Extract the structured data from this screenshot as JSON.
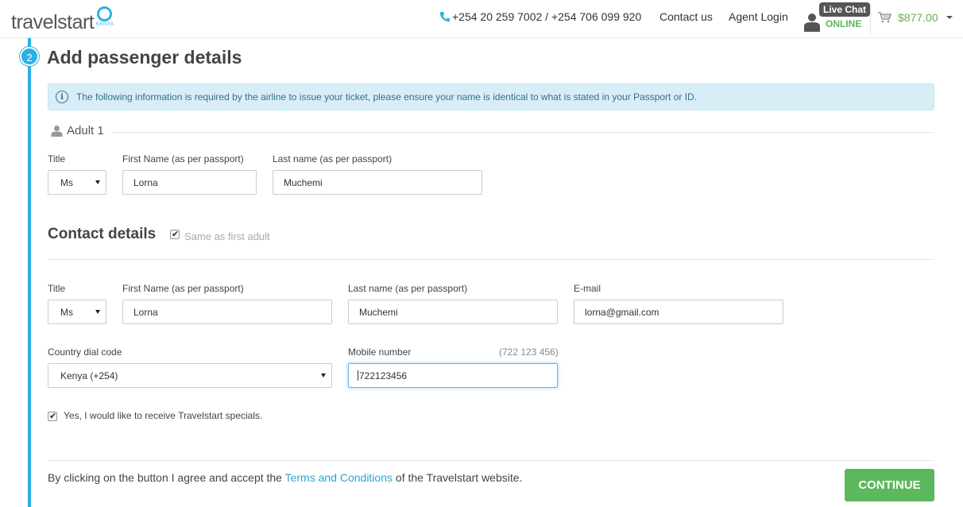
{
  "header": {
    "logo_text": "travelstart",
    "logo_sub": "KENYA",
    "phone": "+254 20 259 7002 / +254 706 099 920",
    "contact_us": "Contact us",
    "agent_login": "Agent Login",
    "live_chat": "Live Chat",
    "chat_status": "ONLINE",
    "cart_amount": "$877.00"
  },
  "step": {
    "number": "2",
    "title": "Add passenger details"
  },
  "info_alert": {
    "icon": "info-icon",
    "text": "The following information is required by the airline to issue your ticket, please ensure your name is identical to what is stated in your Passport or ID."
  },
  "adult": {
    "heading": "Adult 1",
    "title_label": "Title",
    "title_value": "Ms",
    "first_name_label": "First Name (as per passport)",
    "first_name_value": "Lorna",
    "last_name_label": "Last name (as per passport)",
    "last_name_value": "Muchemi"
  },
  "contact": {
    "heading": "Contact details",
    "same_as_first_adult": "Same as first adult",
    "same_checked": true,
    "title_label": "Title",
    "title_value": "Ms",
    "first_name_label": "First Name (as per passport)",
    "first_name_value": "Lorna",
    "last_name_label": "Last name (as per passport)",
    "last_name_value": "Muchemi",
    "email_label": "E-mail",
    "email_value": "lorna@gmail.com",
    "dial_code_label": "Country dial code",
    "dial_code_value": "Kenya (+254)",
    "mobile_label": "Mobile number",
    "mobile_hint": "(722 123 456)",
    "mobile_value": "722123456",
    "specials_label": "Yes, I would like to receive Travelstart specials.",
    "specials_checked": true
  },
  "footer": {
    "terms_prefix": "By clicking on the button I agree and accept the ",
    "terms_link": "Terms and Conditions",
    "terms_suffix": " of the Travelstart website.",
    "continue_label": "CONTINUE"
  },
  "colors": {
    "accent": "#2bb0e4",
    "success": "#5cb85c",
    "info_bg": "#d9edf7"
  }
}
